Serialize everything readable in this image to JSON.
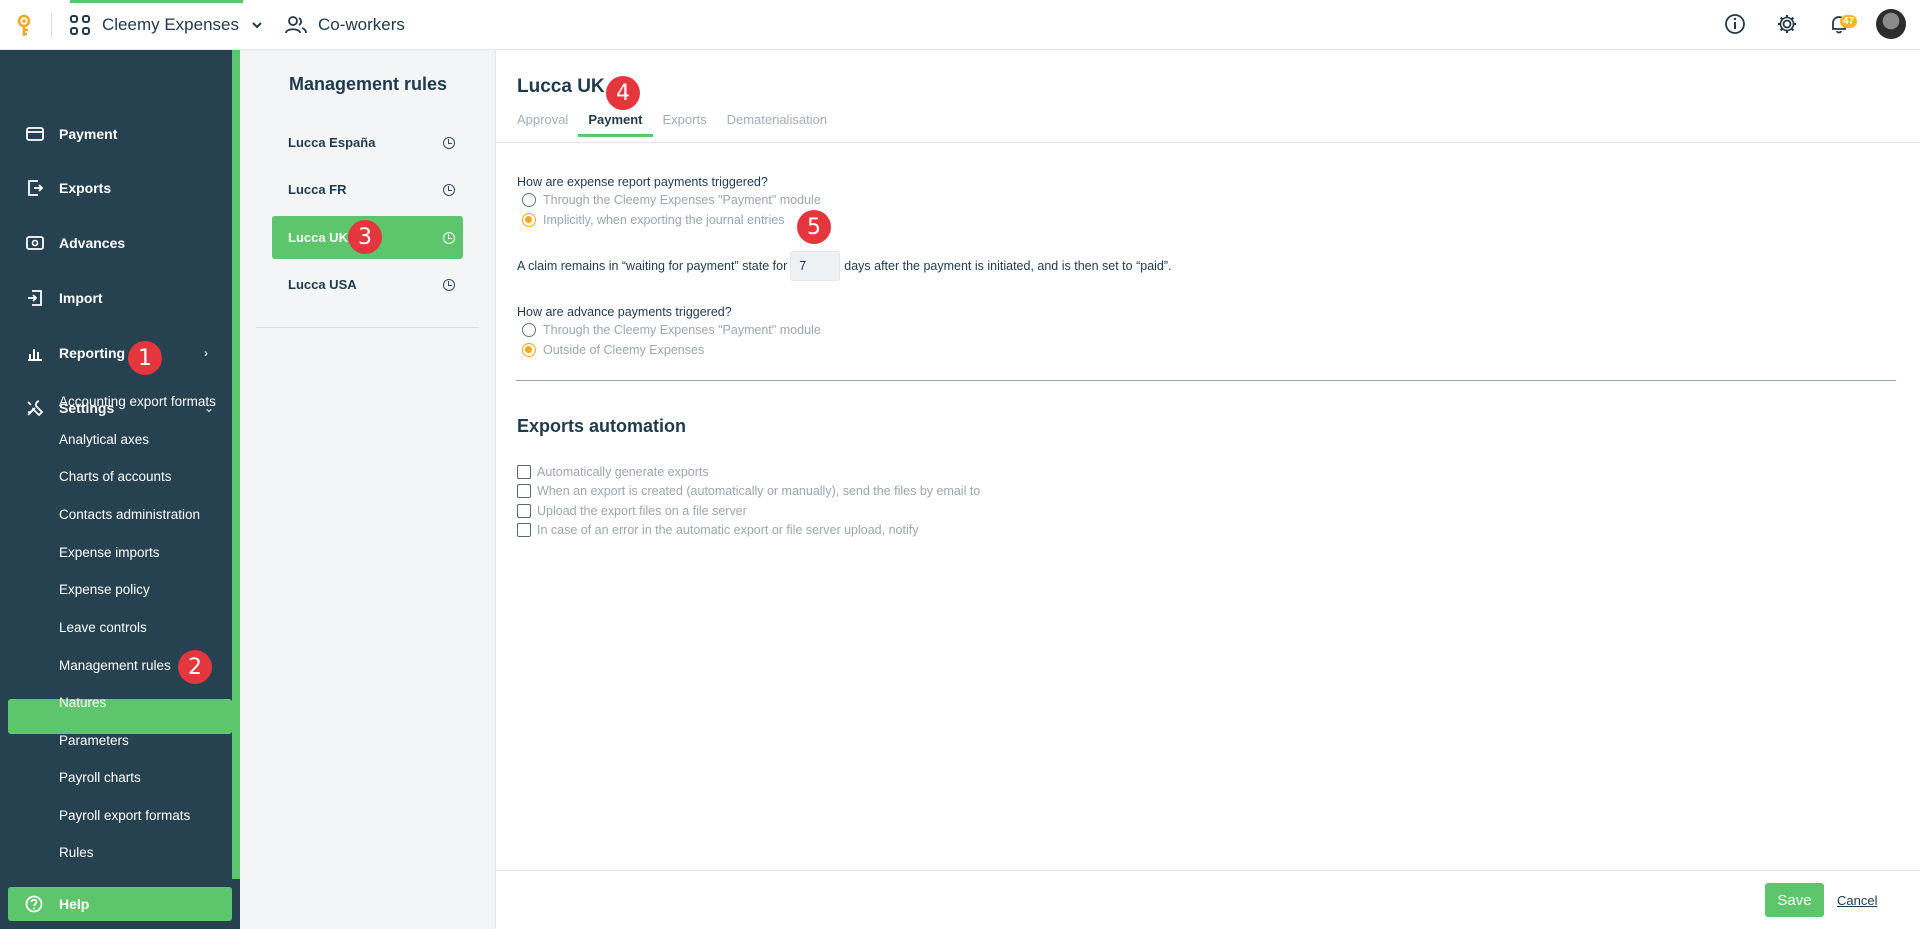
{
  "topbar": {
    "app_name": "Cleemy Expenses",
    "coworkers": "Co-workers",
    "notifications_count": "47"
  },
  "sidebar": {
    "items": [
      {
        "label": "Payment",
        "icon": "card-icon"
      },
      {
        "label": "Exports",
        "icon": "export-icon"
      },
      {
        "label": "Advances",
        "icon": "advances-icon"
      },
      {
        "label": "Import",
        "icon": "import-icon"
      },
      {
        "label": "Reporting",
        "icon": "chart-icon"
      },
      {
        "label": "Settings",
        "icon": "tools-icon"
      }
    ],
    "settings_sub": [
      "Accounting export formats",
      "Analytical axes",
      "Charts of accounts",
      "Contacts administration",
      "Expense imports",
      "Expense policy",
      "Leave controls",
      "Management rules",
      "Natures",
      "Parameters",
      "Payroll charts",
      "Payroll export formats",
      "Rules"
    ],
    "help": "Help"
  },
  "rules_panel": {
    "title": "Management rules",
    "items": [
      "Lucca España",
      "Lucca FR",
      "Lucca UK",
      "Lucca USA"
    ]
  },
  "main": {
    "title": "Lucca UK",
    "tabs": [
      "Approval",
      "Payment",
      "Exports",
      "Dematerialisation"
    ],
    "q1": "How are expense report payments triggered?",
    "q1_options": [
      "Through the Cleemy Expenses \"Payment\" module",
      "Implicitly, when exporting the journal entries"
    ],
    "claim_before": "A claim remains in “waiting for payment” state for",
    "claim_days": "7",
    "claim_after": "days after the payment is initiated, and is then set to “paid”.",
    "q2": "How are advance payments triggered?",
    "q2_options": [
      "Through the Cleemy Expenses \"Payment\" module",
      "Outside of Cleemy Expenses"
    ],
    "exports_title": "Exports automation",
    "checks": [
      "Automatically generate exports",
      "When an export is created (automatically or manually), send the files by email to",
      "Upload the export files on a file server",
      "In case of an error in the automatic export or file server upload, notify"
    ],
    "save": "Save",
    "cancel": "Cancel"
  },
  "badges": [
    "1",
    "2",
    "3",
    "4",
    "5"
  ],
  "colors": {
    "accent": "#5dc56b",
    "sidebar": "#264150",
    "badge": "#e4363d",
    "radio": "#f5a623"
  }
}
